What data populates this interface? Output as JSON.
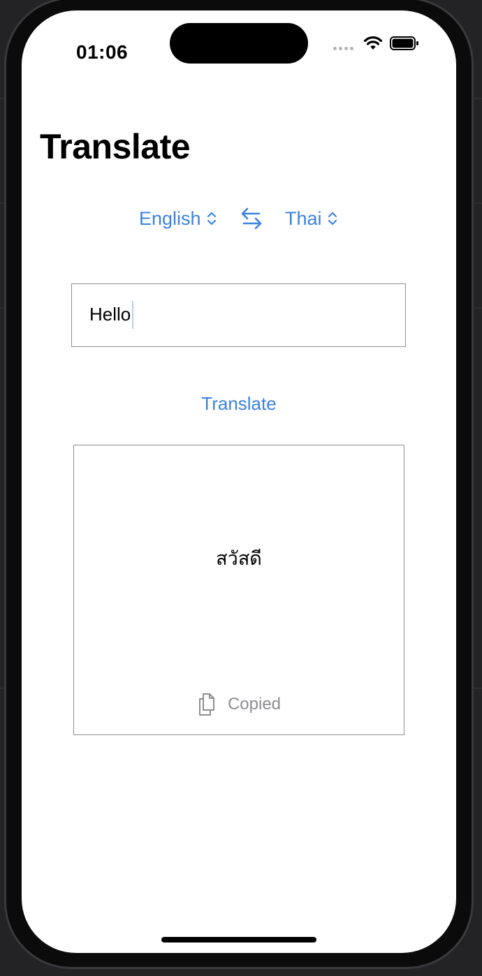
{
  "status_bar": {
    "time": "01:06"
  },
  "page": {
    "title": "Translate"
  },
  "languages": {
    "source": "English",
    "target": "Thai",
    "swap_icon": "swap-arrows-icon"
  },
  "input": {
    "value": "Hello"
  },
  "actions": {
    "translate_label": "Translate"
  },
  "output": {
    "text": "สวัสดี",
    "copied_label": "Copied",
    "copy_icon": "doc-on-doc-icon"
  },
  "colors": {
    "accent": "#3b82e0",
    "border": "#8e8e93",
    "muted_text": "#8e8e93"
  }
}
